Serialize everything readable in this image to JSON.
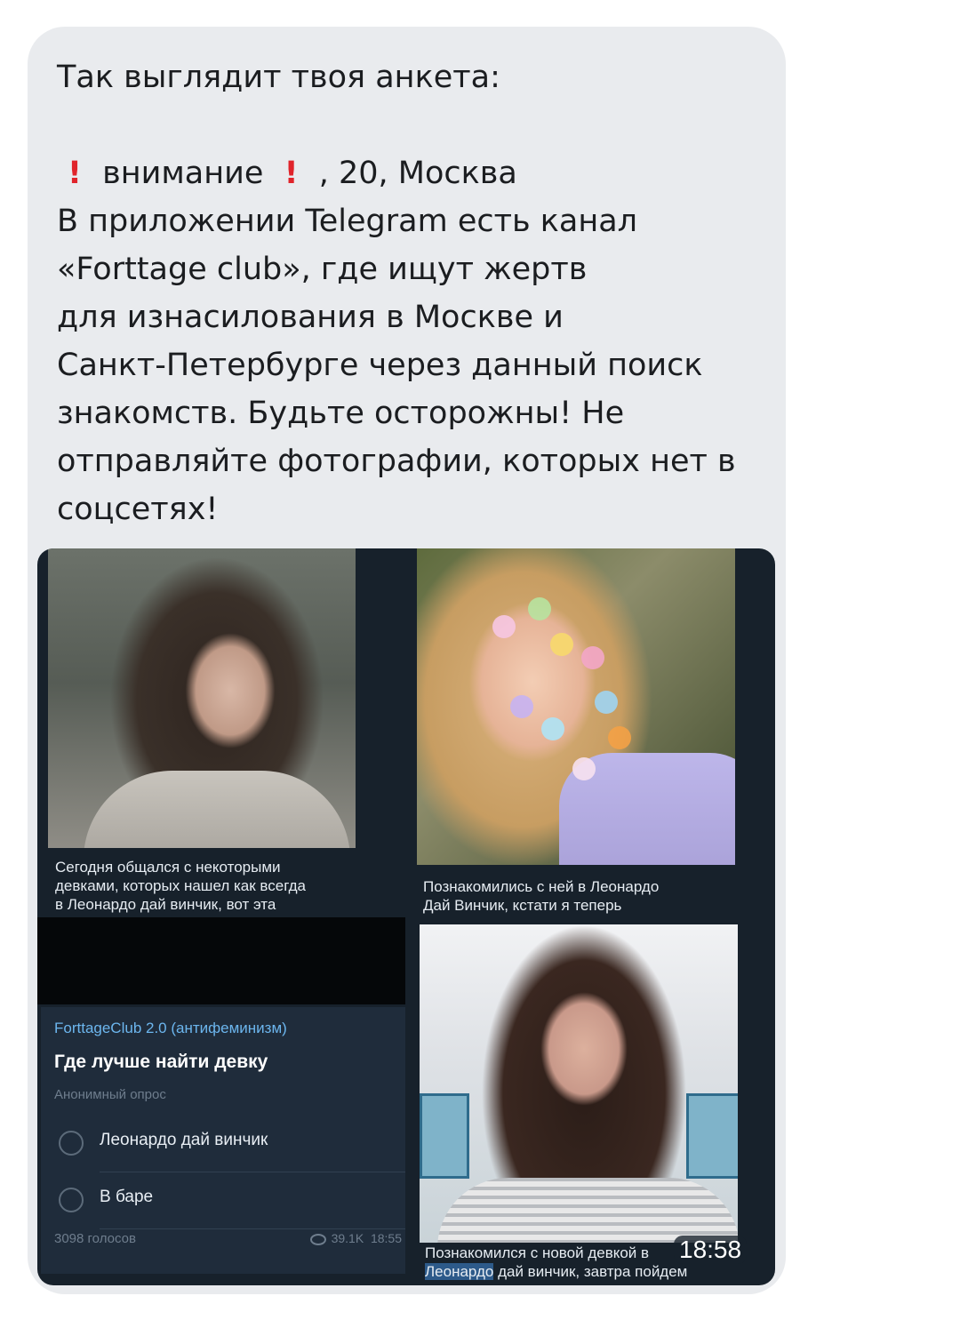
{
  "message": {
    "intro": "Так выглядит твоя анкета:",
    "profile_pre": "внимание",
    "profile_post": ", 20, Москва",
    "excl_symbol": "!",
    "lines": [
      "В приложении Telegram есть канал",
      "«Forttage club», где ищут жертв",
      "для изнасилования в Москве и",
      "Санкт-Петербурге через данный поиск",
      "знакомств. Будьте осторожны! Не",
      "отправляйте фотографии, которых нет в",
      "соцсетях!"
    ]
  },
  "screenshot": {
    "photo1_caption": [
      "Сегодня общался с некоторыми",
      "девками, которых нашел как всегда",
      "в Леонардо дай винчик, вот эта"
    ],
    "photo2_caption": [
      "Познакомились с ней в Леонардо",
      "Дай Винчик, кстати я теперь"
    ],
    "poll": {
      "channel": "ForttageClub 2.0 (антифеминизм)",
      "question": "Где лучше найти девку",
      "type": "Анонимный опрос",
      "options": [
        "Леонардо дай винчик",
        "В баре"
      ],
      "votes": "3098 голосов",
      "views": "39.1K",
      "time": "18:55"
    },
    "photo3_caption": {
      "line1": "Познакомился с новой девкой в",
      "line2_highlight": "Леонардо",
      "line2_rest": " дай винчик, завтра пойдем"
    }
  },
  "message_time": "18:58",
  "colors": {
    "bubble": "#e9ebee",
    "exclamation": "#e0242b",
    "telegram_dark": "#17212b",
    "channel_link": "#6cb6ee"
  }
}
